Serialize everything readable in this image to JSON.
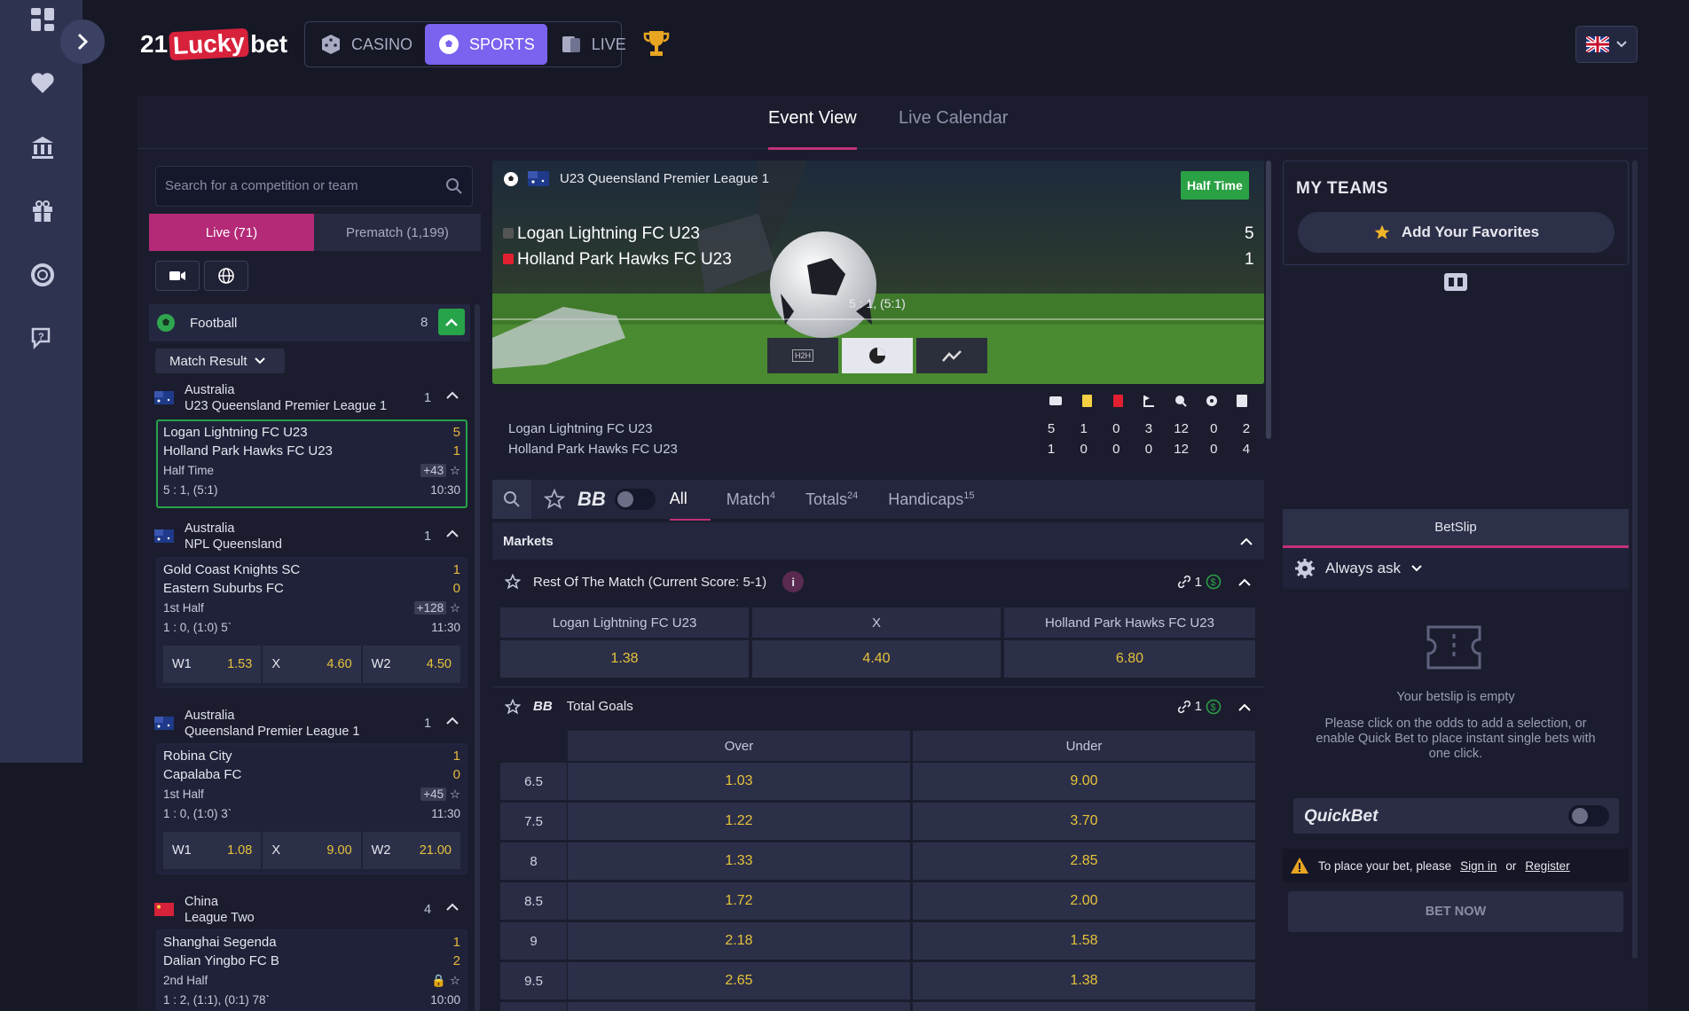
{
  "brand": {
    "pre": "21",
    "mid": "Lucky",
    "post": "bet"
  },
  "nav": {
    "casino": "CASINO",
    "sports": "SPORTS",
    "live": "LIVE"
  },
  "tabs": {
    "event_view": "Event View",
    "live_calendar": "Live Calendar"
  },
  "left": {
    "search_placeholder": "Search for a competition or team",
    "live": "Live (71)",
    "prematch": "Prematch (1,199)",
    "sport": "Football",
    "sport_count": "8",
    "filter": "Match Result",
    "leagues": [
      {
        "country": "Australia",
        "name": "U23 Queensland Premier League 1",
        "count": "1",
        "match": {
          "home": "Logan Lightning FC U23",
          "away": "Holland Park Hawks FC U23",
          "hs": "5",
          "as": "1",
          "period": "Half Time",
          "more": "+43",
          "score_detail": "5 : 1, (5:1)",
          "time": "10:30"
        }
      },
      {
        "country": "Australia",
        "name": "NPL Queensland",
        "count": "1",
        "match": {
          "home": "Gold Coast Knights SC",
          "away": "Eastern Suburbs FC",
          "hs": "1",
          "as": "0",
          "period": "1st Half",
          "more": "+128",
          "score_detail": "1 : 0, (1:0) 5`",
          "time": "11:30",
          "odds": [
            {
              "l": "W1",
              "v": "1.53"
            },
            {
              "l": "X",
              "v": "4.60"
            },
            {
              "l": "W2",
              "v": "4.50"
            }
          ]
        }
      },
      {
        "country": "Australia",
        "name": "Queensland Premier League 1",
        "count": "1",
        "match": {
          "home": "Robina City",
          "away": "Capalaba FC",
          "hs": "1",
          "as": "0",
          "period": "1st Half",
          "more": "+45",
          "score_detail": "1 : 0, (1:0) 3`",
          "time": "11:30",
          "odds": [
            {
              "l": "W1",
              "v": "1.08"
            },
            {
              "l": "X",
              "v": "9.00"
            },
            {
              "l": "W2",
              "v": "21.00"
            }
          ]
        }
      },
      {
        "country": "China",
        "name": "League Two",
        "count": "4",
        "match": {
          "home": "Shanghai Segenda",
          "away": "Dalian Yingbo FC B",
          "hs": "1",
          "as": "2",
          "period": "2nd Half",
          "score_detail": "1 : 2, (1:1), (0:1) 78`",
          "time": "10:00"
        }
      }
    ]
  },
  "event": {
    "league": "U23 Queensland Premier League 1",
    "status": "Half Time",
    "home": "Logan Lightning FC U23",
    "away": "Holland Park Hawks FC U23",
    "home_score": "5",
    "away_score": "1",
    "score_line": "5 : 1, (5:1)",
    "h2h": "H2H",
    "stats_home": [
      "5",
      "1",
      "0",
      "3",
      "12",
      "0",
      "2"
    ],
    "stats_away": [
      "1",
      "0",
      "0",
      "0",
      "12",
      "0",
      "4"
    ]
  },
  "filters": {
    "all": "All",
    "match": "Match",
    "match_n": "4",
    "totals": "Totals",
    "totals_n": "24",
    "handicaps": "Handicaps",
    "handicaps_n": "15"
  },
  "markets": {
    "title": "Markets",
    "rest": {
      "title": "Rest Of The Match (Current Score: 5-1)",
      "link_count": "1",
      "cols": [
        "Logan Lightning FC U23",
        "X",
        "Holland Park Hawks FC U23"
      ],
      "odds": [
        "1.38",
        "4.40",
        "6.80"
      ]
    },
    "totals": {
      "title": "Total Goals",
      "link_count": "1",
      "over": "Over",
      "under": "Under",
      "rows": [
        {
          "line": "6.5",
          "over": "1.03",
          "under": "9.00"
        },
        {
          "line": "7.5",
          "over": "1.22",
          "under": "3.70"
        },
        {
          "line": "8",
          "over": "1.33",
          "under": "2.85"
        },
        {
          "line": "8.5",
          "over": "1.72",
          "under": "2.00"
        },
        {
          "line": "9",
          "over": "2.18",
          "under": "1.58"
        },
        {
          "line": "9.5",
          "over": "2.65",
          "under": "1.38"
        }
      ]
    }
  },
  "right": {
    "my_teams": "MY TEAMS",
    "add_fav": "Add Your Favorites",
    "betslip": "BetSlip",
    "always_ask": "Always ask",
    "empty_title": "Your betslip is empty",
    "empty_text": "Please click on the odds to add a selection, or enable Quick Bet to place instant single bets with one click.",
    "quickbet": "QuickBet",
    "warn_text": "To place your bet, please",
    "sign_in": "Sign in",
    "or": "or",
    "register": "Register",
    "bet_now": "BET NOW"
  },
  "colors": {
    "accent": "#7b62ef",
    "pink": "#c2307a",
    "green": "#28a24a",
    "odds": "#e5c33b"
  }
}
